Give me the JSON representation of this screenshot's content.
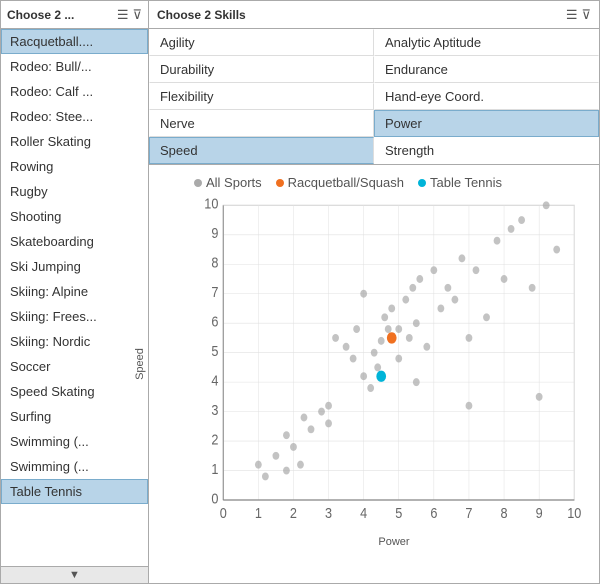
{
  "leftPanel": {
    "title": "Choose 2 ...",
    "items": [
      {
        "label": "Racquetball....",
        "selected": true
      },
      {
        "label": "Rodeo: Bull/...",
        "selected": false
      },
      {
        "label": "Rodeo: Calf ...",
        "selected": false
      },
      {
        "label": "Rodeo: Stee...",
        "selected": false
      },
      {
        "label": "Roller Skating",
        "selected": false
      },
      {
        "label": "Rowing",
        "selected": false
      },
      {
        "label": "Rugby",
        "selected": false
      },
      {
        "label": "Shooting",
        "selected": false
      },
      {
        "label": "Skateboarding",
        "selected": false
      },
      {
        "label": "Ski Jumping",
        "selected": false
      },
      {
        "label": "Skiing: Alpine",
        "selected": false
      },
      {
        "label": "Skiing: Frees...",
        "selected": false
      },
      {
        "label": "Skiing: Nordic",
        "selected": false
      },
      {
        "label": "Soccer",
        "selected": false
      },
      {
        "label": "Speed Skating",
        "selected": false
      },
      {
        "label": "Surfing",
        "selected": false
      },
      {
        "label": "Swimming (...",
        "selected": false
      },
      {
        "label": "Swimming (...",
        "selected": false
      },
      {
        "label": "Table Tennis",
        "selected": true
      }
    ],
    "scrollUpIcon": "▲",
    "scrollDownIcon": "▼"
  },
  "rightPanel": {
    "title": "Choose 2 Skills",
    "skills": [
      {
        "label": "Agility",
        "selected": false,
        "col": 0,
        "row": 0
      },
      {
        "label": "Analytic Aptitude",
        "selected": false,
        "col": 1,
        "row": 0
      },
      {
        "label": "Durability",
        "selected": false,
        "col": 0,
        "row": 1
      },
      {
        "label": "Endurance",
        "selected": false,
        "col": 1,
        "row": 1
      },
      {
        "label": "Flexibility",
        "selected": false,
        "col": 0,
        "row": 2
      },
      {
        "label": "Hand-eye Coord.",
        "selected": false,
        "col": 1,
        "row": 2
      },
      {
        "label": "Nerve",
        "selected": false,
        "col": 0,
        "row": 3
      },
      {
        "label": "Power",
        "selected": true,
        "col": 1,
        "row": 3
      },
      {
        "label": "Speed",
        "selected": true,
        "col": 0,
        "row": 4
      },
      {
        "label": "Strength",
        "selected": false,
        "col": 1,
        "row": 4
      }
    ],
    "legend": {
      "allSports": {
        "label": "All Sports",
        "color": "#aaa"
      },
      "racquetball": {
        "label": "Racquetball/Squash",
        "color": "#f07020"
      },
      "tableTennis": {
        "label": "Table Tennis",
        "color": "#00b4d8"
      }
    },
    "xAxisLabel": "Power",
    "yAxisLabel": "Speed",
    "xMax": 10,
    "yMax": 10
  },
  "icons": {
    "filter": "☰",
    "funnel": "⊽"
  }
}
